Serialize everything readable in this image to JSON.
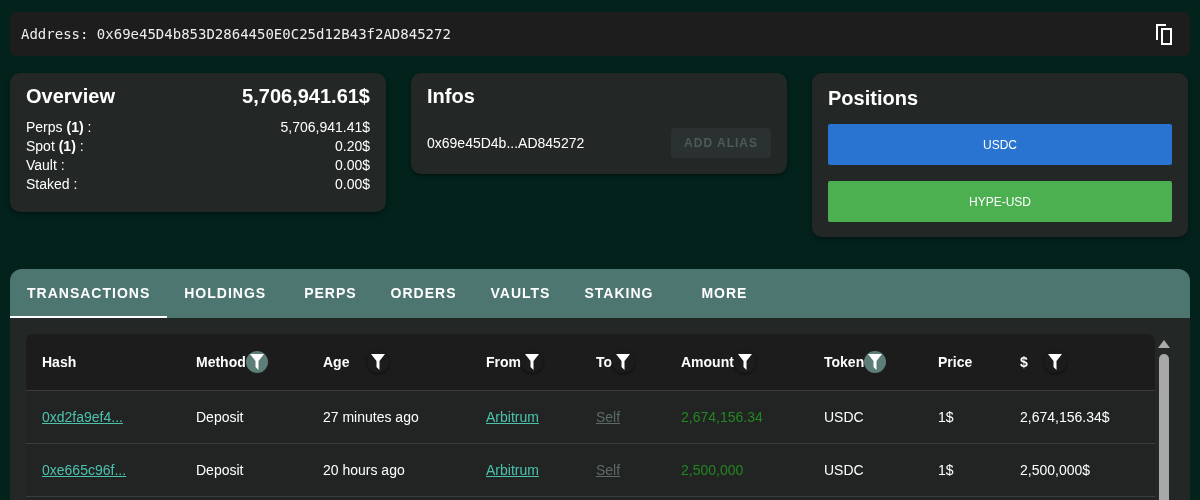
{
  "address_bar": {
    "label": "Address:",
    "value": "0x69e45D4b853D2864450E0C25d12B43f2AD845272"
  },
  "overview": {
    "title": "Overview",
    "total": "5,706,941.61$",
    "rows": [
      {
        "label": "Perps **(1)** :",
        "value": "5,706,941.41$"
      },
      {
        "label": "Spot **(1)** :",
        "value": "0.20$"
      },
      {
        "label": "Vault :",
        "value": "0.00$"
      },
      {
        "label": "Staked :",
        "value": "0.00$"
      }
    ]
  },
  "infos": {
    "title": "Infos",
    "address": "0x69e45D4b...AD845272",
    "button": {
      "label": "ADD ALIAS",
      "disabled": true
    }
  },
  "positions": {
    "title": "Positions",
    "items": [
      {
        "label": "USDC",
        "color": "#2874d0"
      },
      {
        "label": "HYPE-USD",
        "color": "#4caf50"
      }
    ]
  },
  "tabs": [
    {
      "label": "TRANSACTIONS",
      "selected": true
    },
    {
      "label": "HOLDINGS",
      "selected": false
    },
    {
      "label": "PERPS",
      "selected": false
    },
    {
      "label": "ORDERS",
      "selected": false
    },
    {
      "label": "VAULTS",
      "selected": false
    },
    {
      "label": "STAKING",
      "selected": false
    },
    {
      "label": "MORE",
      "selected": false
    }
  ],
  "table": {
    "columns": [
      {
        "label": "Hash"
      },
      {
        "label": "Method",
        "filter": {
          "active": true
        }
      },
      {
        "label": "Age",
        "filter": {
          "active": false
        }
      },
      {
        "label": "From",
        "filter": {
          "active": false
        }
      },
      {
        "label": "To",
        "filter": {
          "active": false
        }
      },
      {
        "label": "Amount",
        "filter": {
          "active": false
        }
      },
      {
        "label": "Token",
        "filter": {
          "active": true
        }
      },
      {
        "label": "Price"
      },
      {
        "label": "$",
        "filter": {
          "active": false
        }
      }
    ],
    "rows": [
      {
        "cells": [
          {
            "kind": "link",
            "text": "0xd2fa9ef4..."
          },
          {
            "kind": "text",
            "text": "Deposit"
          },
          {
            "kind": "text",
            "text": "27 minutes ago"
          },
          {
            "kind": "link",
            "text": "Arbitrum"
          },
          {
            "kind": "muted_link",
            "text": "Self"
          },
          {
            "kind": "positive",
            "text": "2,674,156.34"
          },
          {
            "kind": "text",
            "text": "USDC"
          },
          {
            "kind": "text",
            "text": "1$"
          },
          {
            "kind": "text",
            "text": "2,674,156.34$"
          }
        ]
      },
      {
        "cells": [
          {
            "kind": "link",
            "text": "0xe665c96f..."
          },
          {
            "kind": "text",
            "text": "Deposit"
          },
          {
            "kind": "text",
            "text": "20 hours ago"
          },
          {
            "kind": "link",
            "text": "Arbitrum"
          },
          {
            "kind": "muted_link",
            "text": "Self"
          },
          {
            "kind": "positive",
            "text": "2,500,000"
          },
          {
            "kind": "text",
            "text": "USDC"
          },
          {
            "kind": "text",
            "text": "1$"
          },
          {
            "kind": "text",
            "text": "2,500,000$"
          }
        ]
      }
    ]
  }
}
